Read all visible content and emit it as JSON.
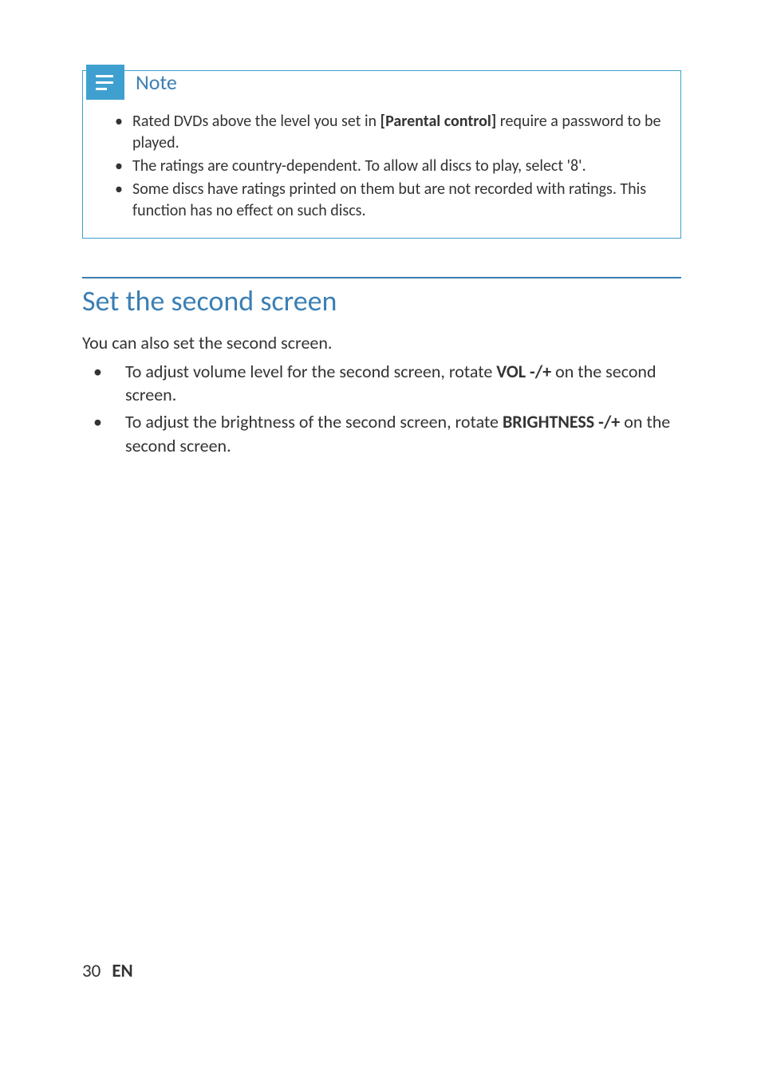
{
  "note": {
    "title": "Note",
    "items": [
      {
        "pre": "Rated DVDs above the level you set in ",
        "bold": "[Parental control]",
        "post": " require a password to be played."
      },
      {
        "pre": "The ratings are country-dependent. To allow all discs to play, select '8'.",
        "bold": "",
        "post": ""
      },
      {
        "pre": "Some discs have ratings printed on them but are not recorded with ratings. This function has no effect on such discs.",
        "bold": "",
        "post": ""
      }
    ]
  },
  "section": {
    "heading": "Set the second screen",
    "intro": "You can also set the second screen.",
    "items": [
      {
        "pre": "To adjust volume level for the second screen, rotate ",
        "bold": "VOL -/+",
        "post": " on the second screen."
      },
      {
        "pre": "To adjust the brightness of the second screen, rotate ",
        "bold": "BRIGHTNESS -/+",
        "post": " on the second screen."
      }
    ]
  },
  "footer": {
    "page": "30",
    "lang": "EN"
  }
}
